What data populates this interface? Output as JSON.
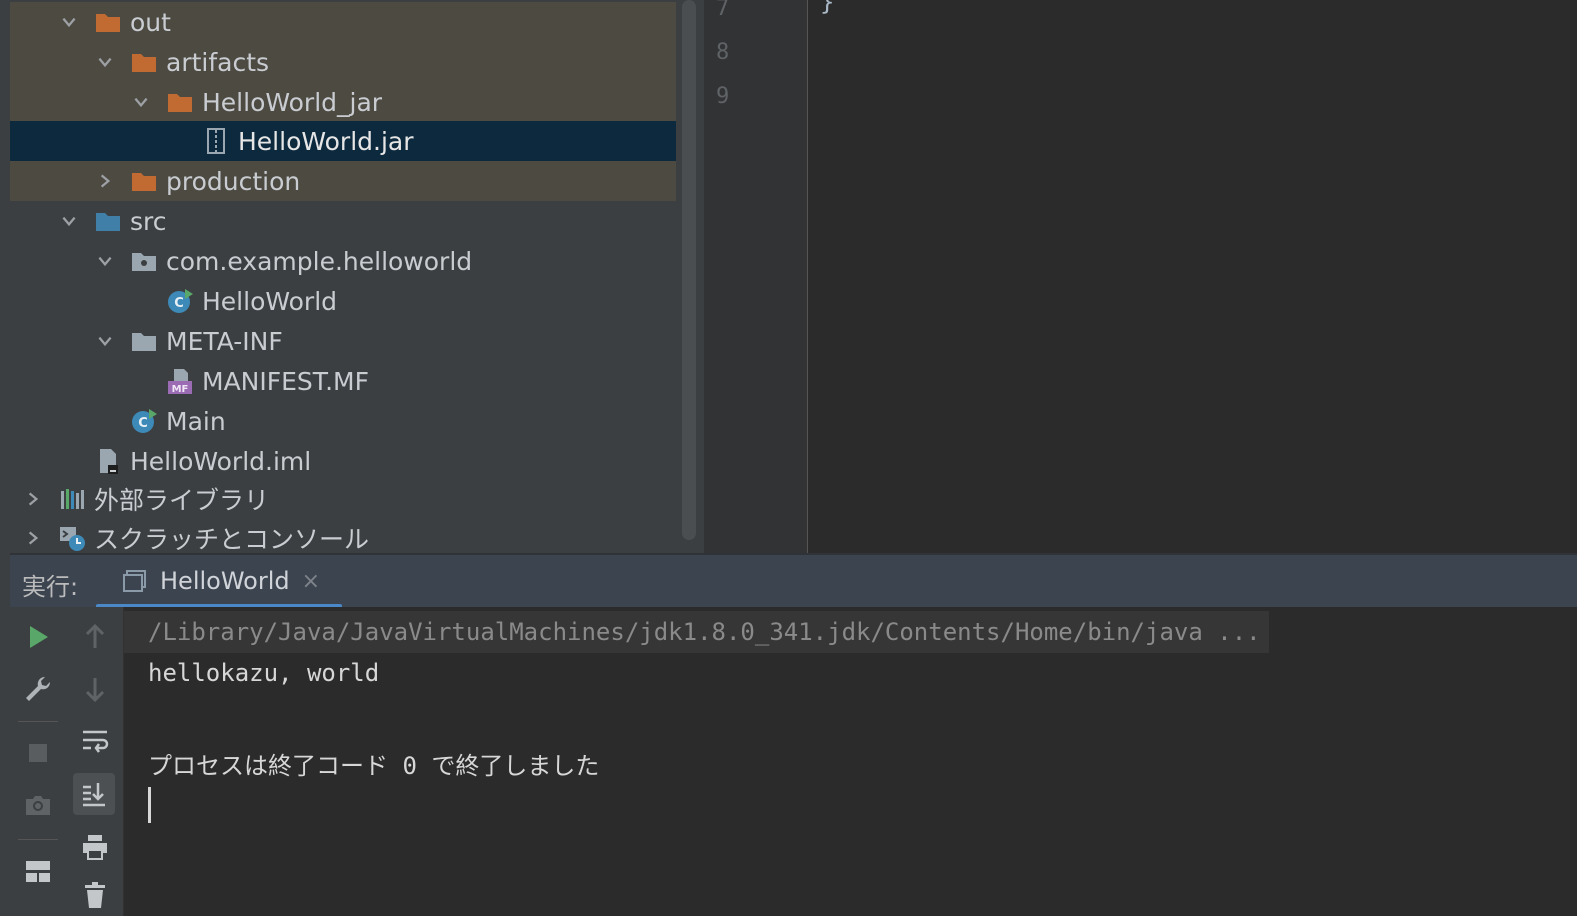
{
  "project_tree": {
    "items": [
      {
        "label": "out",
        "expanded": true,
        "icon": "folder-orange-icon"
      },
      {
        "label": "artifacts",
        "expanded": true,
        "icon": "folder-orange-icon"
      },
      {
        "label": "HelloWorld_jar",
        "expanded": true,
        "icon": "folder-orange-icon"
      },
      {
        "label": "HelloWorld.jar",
        "icon": "jar-file-icon",
        "selected": true
      },
      {
        "label": "production",
        "expanded": false,
        "icon": "folder-orange-icon"
      },
      {
        "label": "src",
        "expanded": true,
        "icon": "folder-blue-icon"
      },
      {
        "label": "com.example.helloworld",
        "expanded": true,
        "icon": "package-icon"
      },
      {
        "label": "HelloWorld",
        "icon": "java-class-runnable-icon"
      },
      {
        "label": "META-INF",
        "expanded": true,
        "icon": "folder-gray-icon"
      },
      {
        "label": "MANIFEST.MF",
        "icon": "manifest-file-icon"
      },
      {
        "label": "Main",
        "icon": "java-class-runnable-icon"
      },
      {
        "label": "HelloWorld.iml",
        "icon": "module-file-icon"
      },
      {
        "label": "外部ライブラリ",
        "expanded": false,
        "icon": "libraries-icon"
      },
      {
        "label": "スクラッチとコンソール",
        "expanded": false,
        "icon": "scratches-icon"
      }
    ]
  },
  "editor": {
    "line_numbers": [
      "7",
      "8",
      "9"
    ],
    "visible_code": "}"
  },
  "run_panel": {
    "label": "実行:",
    "tab_title": "HelloWorld",
    "tab_close": "×",
    "console": {
      "command_line": "/Library/Java/JavaVirtualMachines/jdk1.8.0_341.jdk/Contents/Home/bin/java ...",
      "output_line": "hellokazu, world",
      "exit_message": "プロセスは終了コード 0 で終了しました"
    }
  },
  "colors": {
    "selection": "#0d293e",
    "excluded_folder_bg": "#4d4a42",
    "accent_blue": "#4a88c7",
    "run_green": "#59a869",
    "folder_orange": "#c16a31"
  }
}
